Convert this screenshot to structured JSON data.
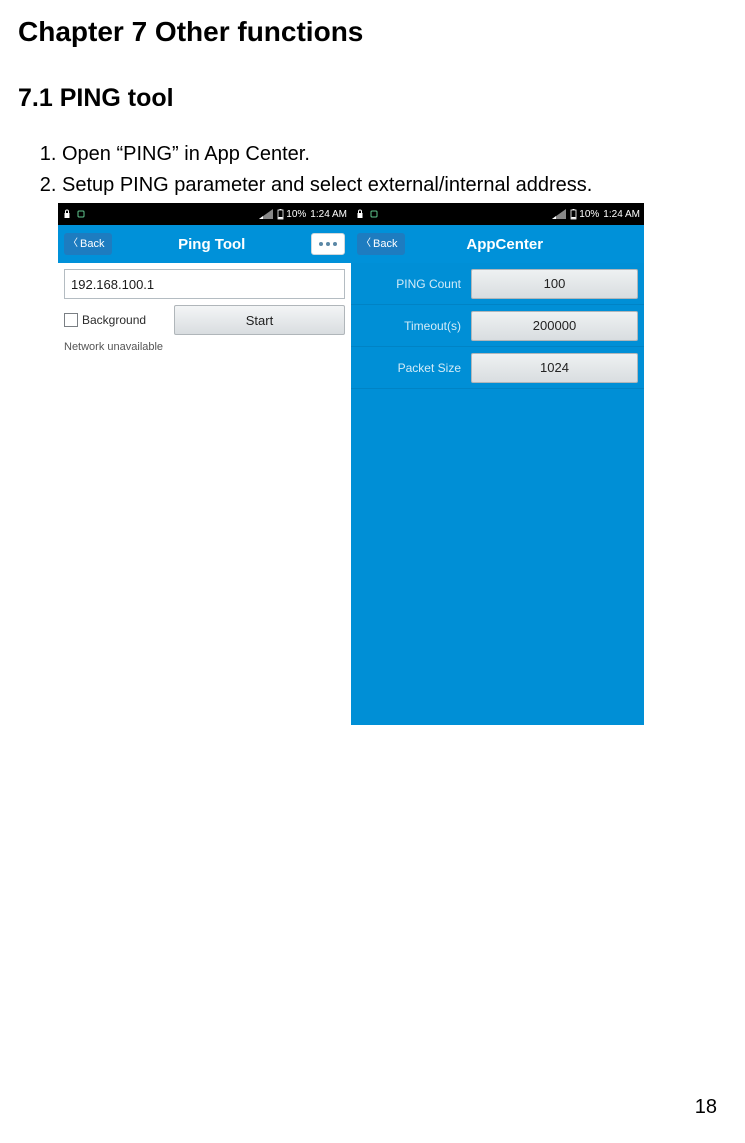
{
  "doc": {
    "chapter_title": "Chapter 7 Other functions",
    "section_title": "7.1 PING tool",
    "steps": [
      "Open “PING” in App Center.",
      "Setup PING parameter and select external/internal address."
    ],
    "page_number": "18"
  },
  "statusbar": {
    "battery_pct": "10%",
    "time": "1:24 AM"
  },
  "phone1": {
    "back_label": "Back",
    "title": "Ping Tool",
    "ip_value": "192.168.100.1",
    "background_label": "Background",
    "start_label": "Start",
    "status": "Network unavailable"
  },
  "phone2": {
    "back_label": "Back",
    "title": "AppCenter",
    "rows": [
      {
        "label": "PING Count",
        "value": "100"
      },
      {
        "label": "Timeout(s)",
        "value": "200000"
      },
      {
        "label": "Packet Size",
        "value": "1024"
      }
    ]
  }
}
